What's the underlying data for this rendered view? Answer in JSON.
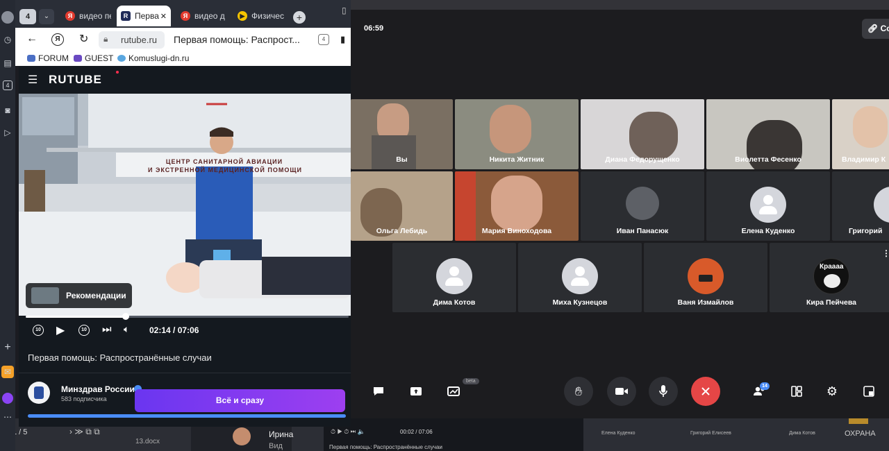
{
  "browser": {
    "tab_count": "4",
    "tabs": [
      {
        "label": "видео пе",
        "favicon": "yandex-icon"
      },
      {
        "label": "Перва",
        "favicon": "rutube-icon"
      },
      {
        "label": "видео д",
        "favicon": "yandex-icon"
      },
      {
        "label": "Физичес",
        "favicon": "play-icon"
      }
    ],
    "address": {
      "domain": "rutube.ru",
      "title": "Первая помощь: Распрост...",
      "badge": "4"
    },
    "bookmarks": [
      "FORUM",
      "GUEST",
      "Komuslugi-dn.ru"
    ]
  },
  "rutube": {
    "logo": "RUTUBE",
    "video_sign_line1": "ЦЕНТР САНИТАРНОЙ АВИАЦИИ",
    "video_sign_line2": "И ЭКСТРЕННОЙ МЕДИЦИНСКОЙ ПОМОЩИ",
    "recommendations_label": "Рекомендации",
    "progress": 0.31,
    "time": "02:14 / 07:06",
    "skip_back": "10",
    "skip_forward": "10",
    "video_title": "Первая помощь: Распространённые случаи",
    "channel_name": "Минздрав России",
    "subscribers": "583 подписчика",
    "cta_label": "Всё и сразу"
  },
  "meeting": {
    "clock": "06:59",
    "top_right_button": "Co",
    "participants_row1": [
      "Вы",
      "Никита Житник",
      "Диана Федорущенко",
      "Виолетта Фесенко",
      "Владимир К"
    ],
    "participants_row2": [
      "Ольга Лебидь",
      "Мария Виноходова",
      "Иван Панасюк",
      "Елена Куденко",
      "Григорий"
    ],
    "participants_row3": [
      "Дима Котов",
      "Миха Кузнецов",
      "Ваня Измайлов",
      "Кира Пейчева"
    ],
    "avatar_caption": "Краааа",
    "beta_label": "beta",
    "participants_badge": "14",
    "colors": {
      "end_call": "#e54646",
      "accent": "#4a8cf6"
    }
  },
  "background": {
    "page_nav": "1 / 5",
    "file_name": "13.docx",
    "person_name": "Ирина",
    "person_sub": "Вид",
    "mini_time": "00:02 / 07:06",
    "mini_title": "Первая помощь: Распространённые случаи",
    "mini_names": [
      "Елена Куденко",
      "Григорий Елисеев",
      "Дима Котов"
    ],
    "right_text": "ОХРАНА"
  }
}
